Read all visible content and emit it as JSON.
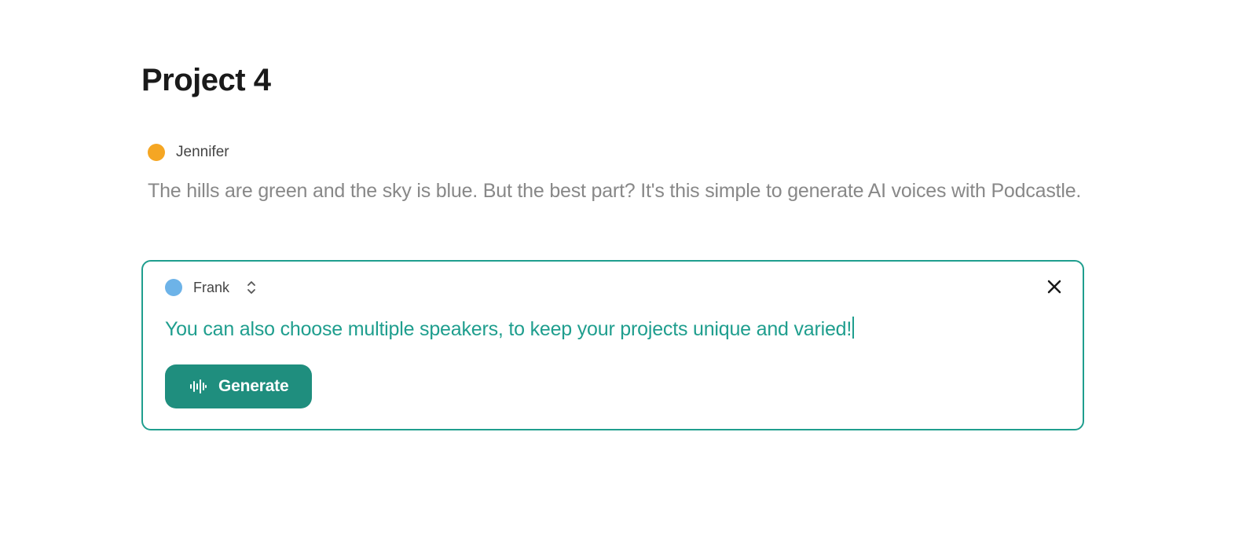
{
  "title": "Project 4",
  "speakers": [
    {
      "name": "Jennifer",
      "color": "#f5a623",
      "text": "The hills are green and the sky is blue. But the best part? It's this simple to generate AI voices with Podcastle."
    }
  ],
  "editor": {
    "speaker": {
      "name": "Frank",
      "color": "#6db3e8"
    },
    "text": "You can also choose multiple speakers, to keep your projects unique and varied!",
    "generate_label": "Generate"
  }
}
